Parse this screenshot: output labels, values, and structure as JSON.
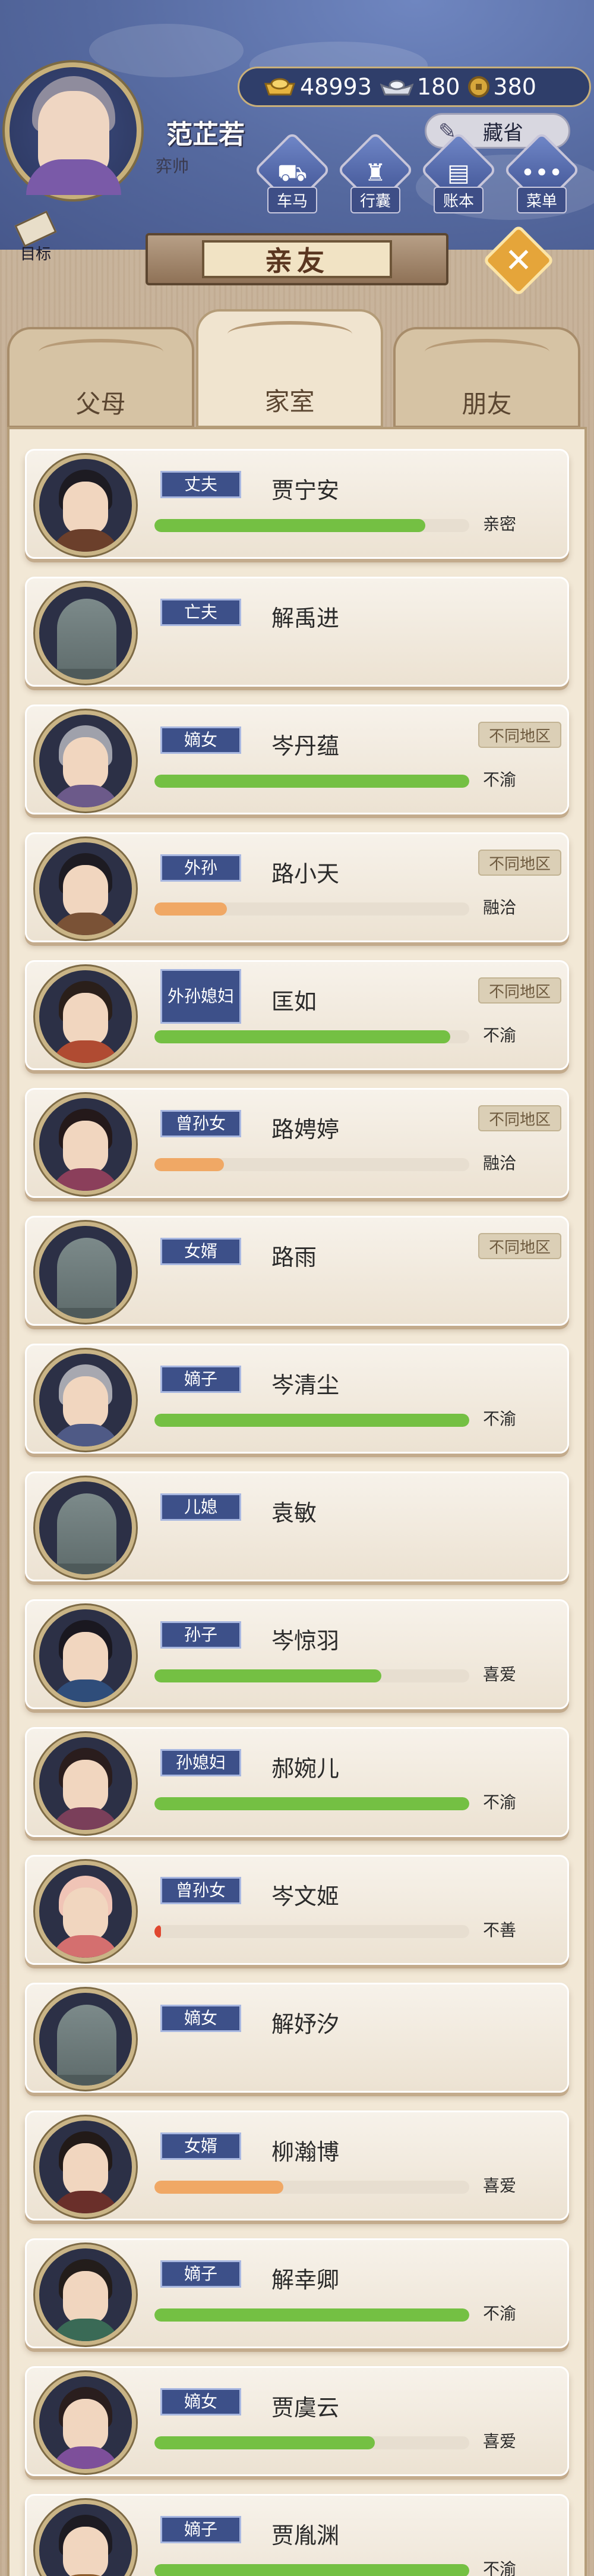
{
  "header": {
    "player_name": "范芷若",
    "player_rank": "弈帅",
    "currency": {
      "gold": "48993",
      "silver": "180",
      "coins": "380"
    },
    "store_label": "藏省",
    "nav": [
      {
        "label": "车马",
        "icon": "carriage-icon"
      },
      {
        "label": "行囊",
        "icon": "bag-icon"
      },
      {
        "label": "账本",
        "icon": "ledger-icon"
      },
      {
        "label": "菜单",
        "icon": "menu-icon"
      }
    ],
    "goal_label": "目标"
  },
  "title": "亲友",
  "tabs": [
    {
      "label": "父母",
      "active": false
    },
    {
      "label": "家室",
      "active": true
    },
    {
      "label": "朋友",
      "active": false
    }
  ],
  "colors": {
    "bar_green": "#74c043",
    "bar_orange": "#f0a865",
    "bar_red": "#e04830",
    "tag_blue": "#3d5089"
  },
  "relatives": [
    {
      "relation": "丈夫",
      "name": "贾宁安",
      "affinity_label": "亲密",
      "affinity": 0.86,
      "bar_color": "green",
      "region": "",
      "portrait": "man-headband",
      "deceased": false
    },
    {
      "relation": "亡夫",
      "name": "解禹进",
      "affinity_label": "",
      "affinity": 0,
      "bar_color": "",
      "region": "",
      "portrait": "tombstone",
      "deceased": true
    },
    {
      "relation": "嫡女",
      "name": "岑丹蕴",
      "affinity_label": "不渝",
      "affinity": 1.0,
      "bar_color": "green",
      "region": "不同地区",
      "portrait": "old-woman",
      "deceased": false
    },
    {
      "relation": "外孙",
      "name": "路小天",
      "affinity_label": "融洽",
      "affinity": 0.23,
      "bar_color": "orange",
      "region": "不同地区",
      "portrait": "young-man",
      "deceased": false
    },
    {
      "relation": "外孙媳妇",
      "name": "匡如",
      "affinity_label": "不渝",
      "affinity": 0.94,
      "bar_color": "green",
      "region": "不同地区",
      "portrait": "lady-crown",
      "deceased": false
    },
    {
      "relation": "曾孙女",
      "name": "路娉婷",
      "affinity_label": "融洽",
      "affinity": 0.22,
      "bar_color": "orange",
      "region": "不同地区",
      "portrait": "girl-flowers",
      "deceased": false
    },
    {
      "relation": "女婿",
      "name": "路雨",
      "affinity_label": "",
      "affinity": 0,
      "bar_color": "",
      "region": "不同地区",
      "portrait": "tombstone",
      "deceased": true
    },
    {
      "relation": "嫡子",
      "name": "岑清尘",
      "affinity_label": "不渝",
      "affinity": 1.0,
      "bar_color": "green",
      "region": "",
      "portrait": "old-man",
      "deceased": false
    },
    {
      "relation": "儿媳",
      "name": "袁敏",
      "affinity_label": "",
      "affinity": 0,
      "bar_color": "",
      "region": "",
      "portrait": "tombstone",
      "deceased": true
    },
    {
      "relation": "孙子",
      "name": "岑惊羽",
      "affinity_label": "喜爱",
      "affinity": 0.72,
      "bar_color": "green",
      "region": "",
      "portrait": "man-topknot",
      "deceased": false
    },
    {
      "relation": "孙媳妇",
      "name": "郝婉儿",
      "affinity_label": "不渝",
      "affinity": 1.0,
      "bar_color": "green",
      "region": "",
      "portrait": "woman-bun",
      "deceased": false
    },
    {
      "relation": "曾孙女",
      "name": "岑文姬",
      "affinity_label": "不善",
      "affinity": 0.02,
      "bar_color": "red",
      "region": "",
      "portrait": "baby",
      "deceased": false
    },
    {
      "relation": "嫡女",
      "name": "解妤汐",
      "affinity_label": "",
      "affinity": 0,
      "bar_color": "",
      "region": "",
      "portrait": "tombstone",
      "deceased": true
    },
    {
      "relation": "女婿",
      "name": "柳瀚博",
      "affinity_label": "喜爱",
      "affinity": 0.41,
      "bar_color": "orange",
      "region": "",
      "portrait": "man-long-hair",
      "deceased": false
    },
    {
      "relation": "嫡子",
      "name": "解幸卿",
      "affinity_label": "不渝",
      "affinity": 1.0,
      "bar_color": "green",
      "region": "",
      "portrait": "man-bun",
      "deceased": false
    },
    {
      "relation": "嫡女",
      "name": "贾虞云",
      "affinity_label": "喜爱",
      "affinity": 0.7,
      "bar_color": "green",
      "region": "",
      "portrait": "woman-hairpins",
      "deceased": false
    },
    {
      "relation": "嫡子",
      "name": "贾胤渊",
      "affinity_label": "不渝",
      "affinity": 1.0,
      "bar_color": "green",
      "region": "",
      "portrait": "boy-buns",
      "deceased": false
    }
  ]
}
